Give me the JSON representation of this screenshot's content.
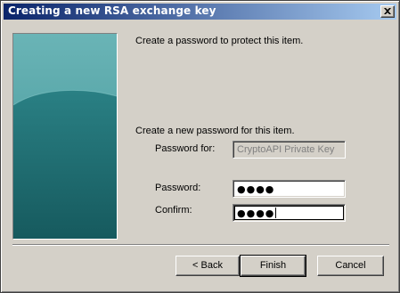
{
  "window": {
    "title": "Creating a new RSA exchange key"
  },
  "intro": {
    "text": "Create a password to protect this item."
  },
  "form": {
    "heading": "Create a new password for this item.",
    "password_for_label": "Password for:",
    "password_for_value": "CryptoAPI Private Key",
    "password_label": "Password:",
    "password_value": "●●●●",
    "confirm_label": "Confirm:",
    "confirm_value": "●●●●"
  },
  "buttons": {
    "back": "< Back",
    "finish": "Finish",
    "cancel": "Cancel"
  },
  "icons": {
    "close": "close-icon"
  },
  "colors": {
    "title_bar_start": "#0a246a",
    "title_bar_end": "#a6caf0",
    "dialog_face": "#d4d0c8",
    "graphic_teal": "#2a7f83"
  }
}
